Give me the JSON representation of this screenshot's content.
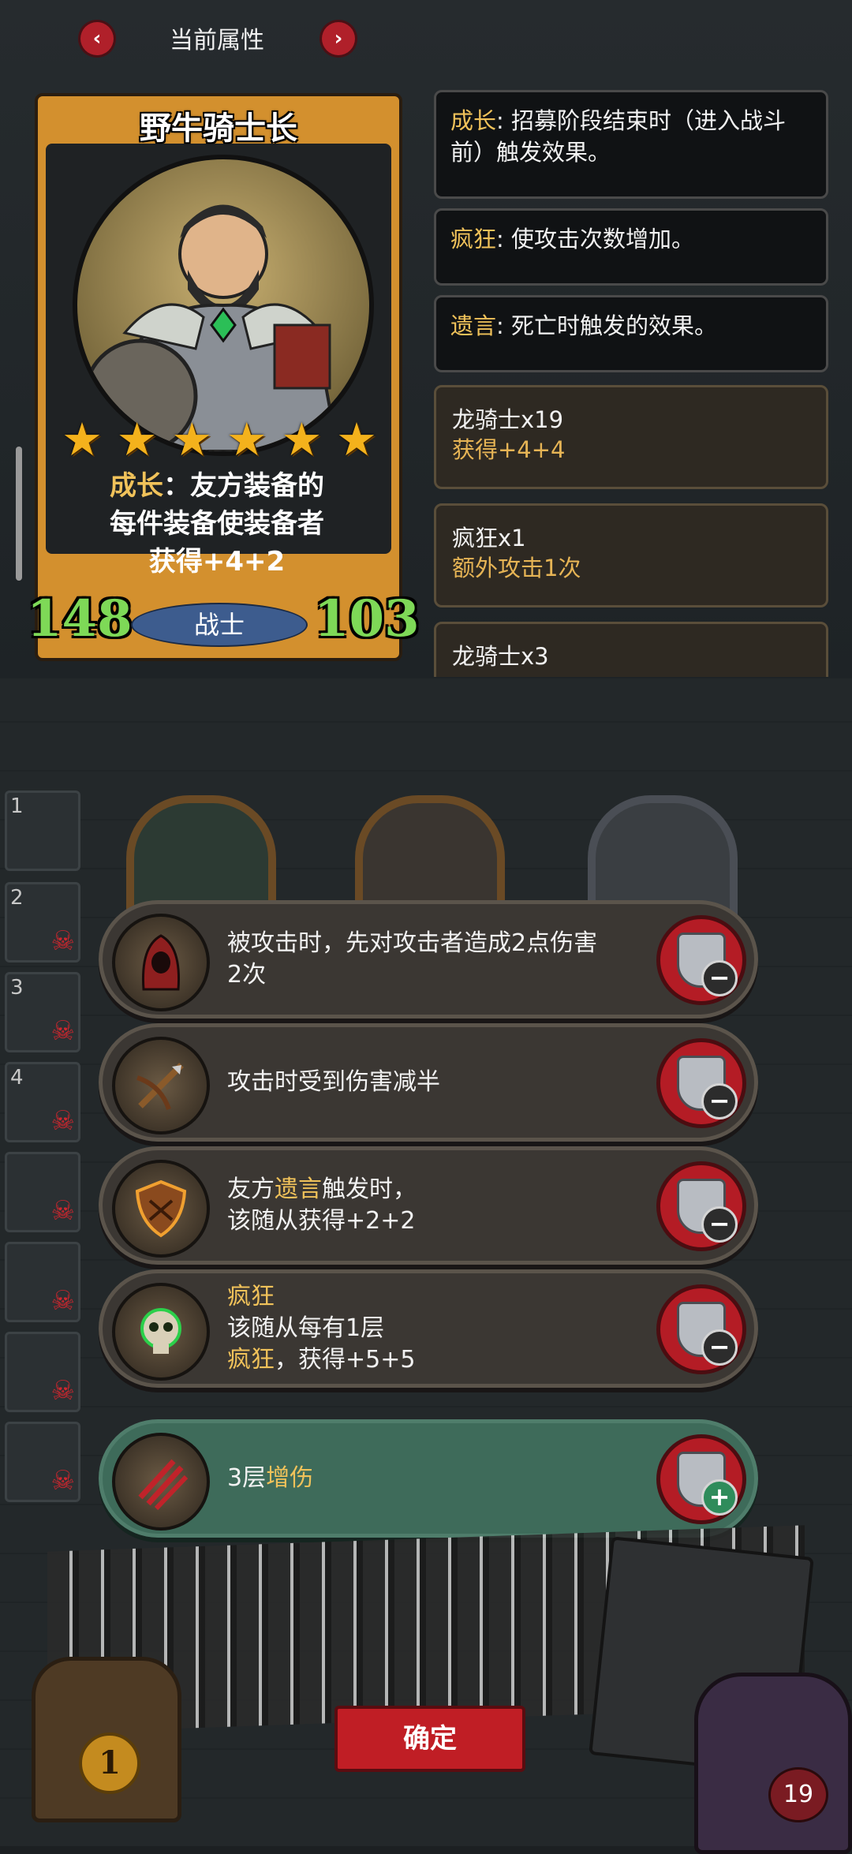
{
  "header": {
    "title": "当前属性",
    "prev_icon": "chevron-left-icon",
    "next_icon": "chevron-right-icon",
    "prev_glyph": "‹",
    "next_glyph": "›"
  },
  "card": {
    "name": "野牛骑士长",
    "stars": 6,
    "desc_keyword": "成长",
    "desc_sep": "：",
    "desc_rest_1": "友方装备的",
    "desc_line_2": "每件装备使装备者",
    "desc_line_3": "获得+4+2",
    "attack": "148",
    "health": "103",
    "class": "战士"
  },
  "keywords": [
    {
      "name": "成长",
      "sep": ": ",
      "text": "招募阶段结束时（进入战斗前）触发效果。"
    },
    {
      "name": "疯狂",
      "sep": ": ",
      "text": "使攻击次数增加。"
    },
    {
      "name": "遗言",
      "sep": ": ",
      "text": "死亡时触发的效果。"
    }
  ],
  "buffs": [
    {
      "name": "龙骑士x19",
      "effect": "获得+4+4"
    },
    {
      "name": "疯狂x1",
      "effect": "额外攻击1次"
    },
    {
      "name": "龙骑士x3",
      "effect": ""
    }
  ],
  "left_slots": [
    "1",
    "2",
    "3",
    "4",
    "",
    "",
    "",
    ""
  ],
  "options": [
    {
      "icon": "hooded-figure-icon",
      "line1": "被攻击时，先对攻击者造成2点伤害",
      "line2": "2次",
      "button": "minus"
    },
    {
      "icon": "crossbow-icon",
      "line1": "攻击时受到伤害减半",
      "line2": "",
      "button": "minus"
    },
    {
      "icon": "wooden-shield-icon",
      "line1_a": "友方",
      "line1_kw": "遗言",
      "line1_b": "触发时，",
      "line2": "该随从获得+2+2",
      "button": "minus"
    },
    {
      "icon": "green-skull-icon",
      "line1_kw": "疯狂",
      "line2": "该随从每有1层",
      "line3_kw": "疯狂",
      "line3_b": "，获得+5+5",
      "button": "minus"
    },
    {
      "icon": "claw-slash-icon",
      "line1_a": "3层",
      "line1_kw": "增伤",
      "button": "plus"
    }
  ],
  "bottom": {
    "confirm": "确定",
    "coins": "1",
    "hp": "19"
  },
  "colors": {
    "keyword": "#f0c25a",
    "attack": "#7ed957",
    "button_red": "#c01e25",
    "card_gold": "#d3902e",
    "selected_row": "#3e6b5a"
  }
}
